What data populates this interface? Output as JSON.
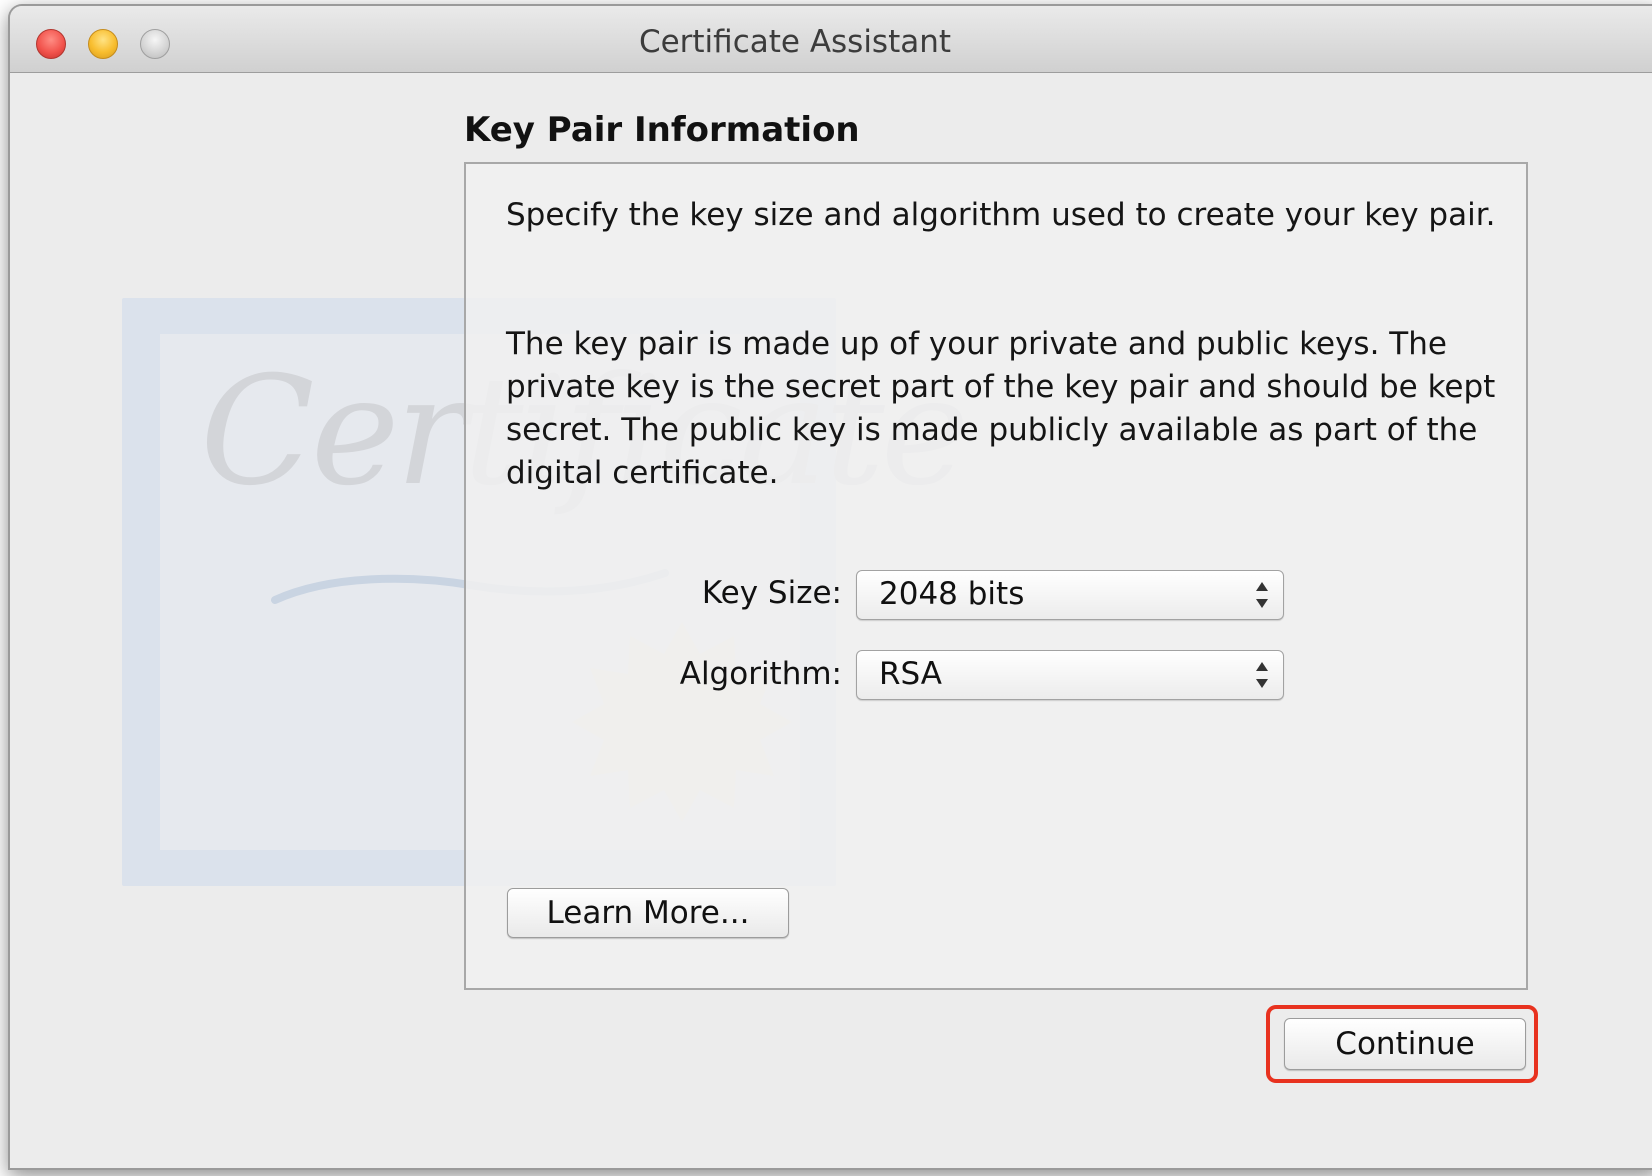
{
  "window": {
    "title": "Certificate Assistant"
  },
  "watermark": {
    "text": "Certificate"
  },
  "content": {
    "heading": "Key Pair Information",
    "paragraph1": "Specify the key size and algorithm used to create your key pair.",
    "paragraph2": "The key pair is made up of your private and public keys. The private key is the secret part of the key pair and should be kept secret. The public key is made publicly available as part of the digital certificate."
  },
  "form": {
    "key_size_label": "Key Size:",
    "key_size_value": "2048 bits",
    "algorithm_label": "Algorithm:",
    "algorithm_value": "RSA"
  },
  "buttons": {
    "learn_more": "Learn More...",
    "continue": "Continue"
  },
  "colors": {
    "highlight": "#e8321f",
    "close": "#f2544d",
    "minimize": "#f8bd2e"
  },
  "icons": [
    "close-icon",
    "minimize-icon",
    "zoom-icon",
    "popup-arrows-icon",
    "certificate-seal-icon"
  ]
}
